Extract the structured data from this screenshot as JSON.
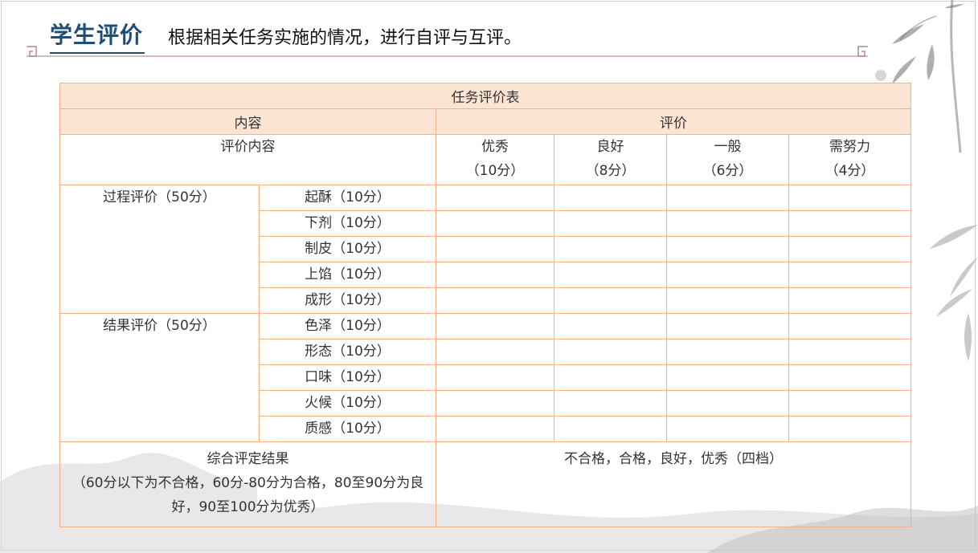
{
  "header": {
    "title": "学生评价",
    "subtitle": "根据相关任务实施的情况，进行自评与互评。"
  },
  "table": {
    "caption": "任务评价表",
    "col_content": "内容",
    "col_eval": "评价",
    "eval_content_label": "评价内容",
    "grades": [
      {
        "name": "优秀",
        "score": "（10分）"
      },
      {
        "name": "良好",
        "score": "（8分）"
      },
      {
        "name": "一般",
        "score": "（6分）"
      },
      {
        "name": "需努力",
        "score": "（4分）"
      }
    ],
    "groups": [
      {
        "label": "过程评价（50分）",
        "items": [
          "起酥（10分）",
          "下剂（10分）",
          "制皮（10分）",
          "上馅（10分）",
          "成形（10分）"
        ]
      },
      {
        "label": "结果评价（50分）",
        "items": [
          "色泽（10分）",
          "形态（10分）",
          "口味（10分）",
          "火候（10分）",
          "质感（10分）"
        ]
      }
    ],
    "summary": {
      "label": "综合评定结果",
      "note": "（60分以下为不合格，60分-80分为合格，80至90分为良好，90至100分为优秀）",
      "result": "不合格，合格，良好，优秀（四档）"
    }
  }
}
